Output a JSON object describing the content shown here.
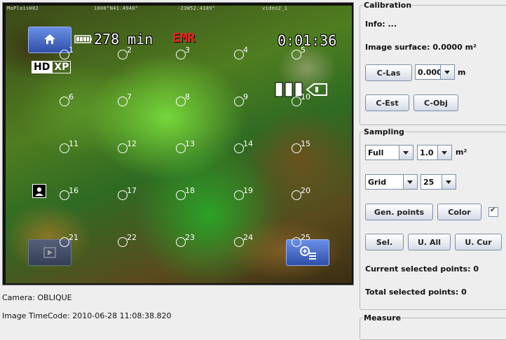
{
  "video": {
    "overlay_text": [
      "MaPlaisH02",
      "1800°N41.4940°",
      "-23W52.4189°",
      "video2_1"
    ],
    "recording_time": "278 min",
    "emr_label": "EMR",
    "elapsed": "0:01:36",
    "badge_hd": "HD",
    "badge_xp": "XP",
    "icons": {
      "home": "home-icon",
      "battery": "battery-icon",
      "memory_card": "memory-card-icon",
      "contact": "contact-icon",
      "play": "play-icon",
      "zoom": "zoom-icon"
    },
    "sample_points": [
      "1",
      "2",
      "3",
      "4",
      "5",
      "6",
      "7",
      "8",
      "9",
      "10",
      "11",
      "12",
      "13",
      "14",
      "15",
      "16",
      "17",
      "18",
      "19",
      "20",
      "21",
      "22",
      "23",
      "24",
      "25"
    ]
  },
  "info": {
    "camera": "Camera: OBLIQUE",
    "timecode": "Image TimeCode: 2010-06-28 11:08:38.820"
  },
  "calibration": {
    "title": "Calibration",
    "info_label": "Info: ...",
    "surface_label": "Image surface: 0.0000 m²",
    "c_las": "C-Las",
    "distance_value": "0.000",
    "distance_unit": "m",
    "c_est": "C-Est",
    "c_obj": "C-Obj"
  },
  "sampling": {
    "title": "Sampling",
    "mode_value": "Full",
    "size_value": "1.0",
    "size_unit": "m²",
    "pattern_value": "Grid",
    "count_value": "25",
    "gen_points": "Gen. points",
    "color": "Color",
    "color_checked": true,
    "sel": "Sel.",
    "u_all": "U. All",
    "u_cur": "U. Cur",
    "current_selected": "Current selected points: 0",
    "total_selected": "Total selected points: 0"
  },
  "measure": {
    "title": "Measure"
  }
}
